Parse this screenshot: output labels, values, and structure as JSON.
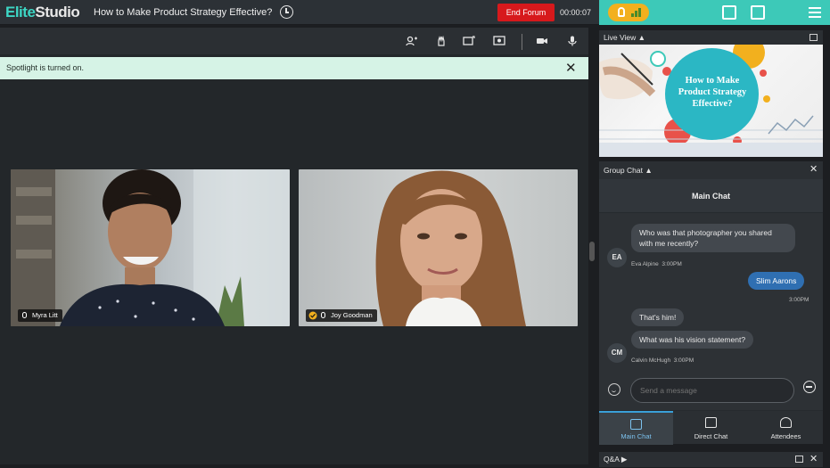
{
  "header": {
    "brand_part1": "Elite",
    "brand_part2": "Studio",
    "session_title": "How to Make Product Strategy Effective?",
    "end_button": "End Forum",
    "timer": "00:00:07"
  },
  "notification": {
    "text": "Spotlight is turned on.",
    "close": "✕"
  },
  "participants": [
    {
      "name": "Myra Litt"
    },
    {
      "name": "Joy Goodman"
    }
  ],
  "live_view": {
    "label": "Live View",
    "slide_title": "How to Make Product Strategy Effective?"
  },
  "chat": {
    "panel_label": "Group Chat",
    "title": "Main Chat",
    "messages": [
      {
        "initials": "EA",
        "text": "Who was that photographer you shared with me recently?",
        "author": "Eva Alpine",
        "time": "3:00PM"
      },
      {
        "text": "Slim Aarons",
        "time": "3:00PM",
        "own": true
      },
      {
        "text": "That's him!"
      },
      {
        "initials": "CM",
        "text": "What was his vision statement?",
        "author": "Calvin McHugh",
        "time": "3:00PM"
      }
    ],
    "input_placeholder": "Send a message"
  },
  "tabs": [
    {
      "label": "Main Chat",
      "active": true
    },
    {
      "label": "Direct Chat"
    },
    {
      "label": "Attendees"
    }
  ],
  "qa": {
    "label": "Q&A"
  },
  "colors": {
    "accent": "#3dc9b8",
    "danger": "#d7191c",
    "own_bubble": "#2f6fb2",
    "status_pill": "#f2b01e"
  }
}
